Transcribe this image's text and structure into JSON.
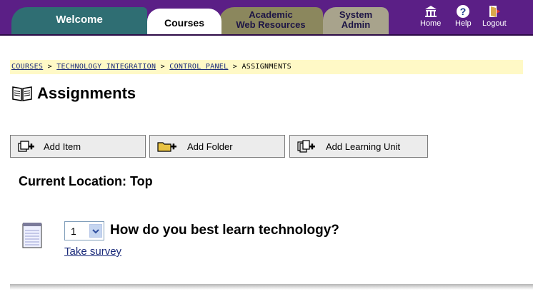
{
  "nav": {
    "tabs": [
      {
        "label_line1": "Welcome",
        "label_line2": ""
      },
      {
        "label_line1": "Courses",
        "label_line2": ""
      },
      {
        "label_line1": "Academic",
        "label_line2": "Web Resources"
      },
      {
        "label_line1": "System",
        "label_line2": "Admin"
      }
    ],
    "active_tab": "Courses",
    "utilities": {
      "home": "Home",
      "help": "Help",
      "logout": "Logout"
    }
  },
  "breadcrumb": {
    "items": [
      "COURSES",
      "TECHNOLOGY INTEGRATION",
      "CONTROL PANEL",
      "ASSIGNMENTS"
    ],
    "separator": ">"
  },
  "page": {
    "title": "Assignments",
    "icon": "open-book-icon"
  },
  "actions": {
    "add_item": "Add Item",
    "add_folder": "Add Folder",
    "add_learning_unit": "Add Learning Unit"
  },
  "location": {
    "text": "Current Location: Top"
  },
  "items": [
    {
      "order": "1",
      "title": "How do you best learn technology?",
      "link": "Take survey",
      "icon": "notepad-icon"
    }
  ],
  "colors": {
    "nav_bg": "#5b1f86",
    "welcome_tab": "#2f6e73",
    "academic_tab": "#8b875d",
    "sysadmin_tab": "#a8a38c",
    "link": "#1a2a7a"
  }
}
